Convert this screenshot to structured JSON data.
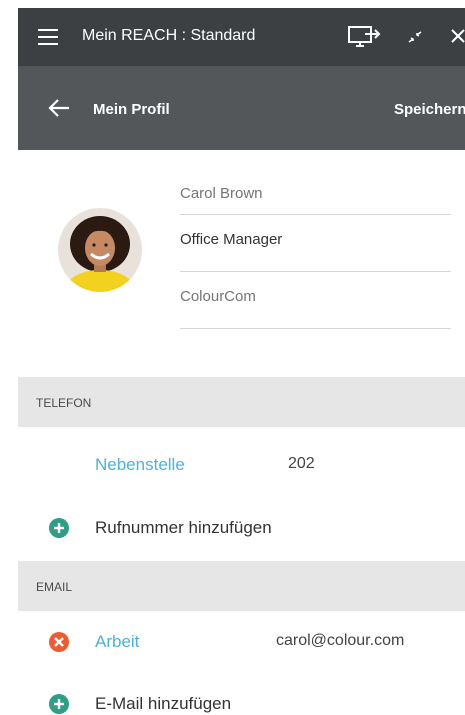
{
  "window": {
    "title": "Mein REACH : Standard",
    "icons": [
      "menu-icon",
      "screen-share-icon",
      "collapse-icon",
      "close-icon"
    ]
  },
  "toolbar": {
    "page_title": "Mein Profil",
    "save_label": "Speichern"
  },
  "profile": {
    "name_placeholder": "Carol Brown",
    "role_value": "Office Manager",
    "company_placeholder": "ColourCom"
  },
  "telefon": {
    "header": "TELEFON",
    "extension_label": "Nebenstelle",
    "extension_value": "202",
    "add_label": "Rufnummer hinzufügen"
  },
  "email": {
    "header": "EMAIL",
    "work_label": "Arbeit",
    "work_value": "carol@colour.com",
    "add_label": "E-Mail hinzufügen"
  },
  "colors": {
    "titlebar_bg": "#3d4042",
    "toolbar_bg": "#54575a",
    "link": "#4bb3d9",
    "add_icon": "#2e9e87",
    "remove_icon": "#ef5a2f",
    "section_bg": "#e6e6e6"
  }
}
